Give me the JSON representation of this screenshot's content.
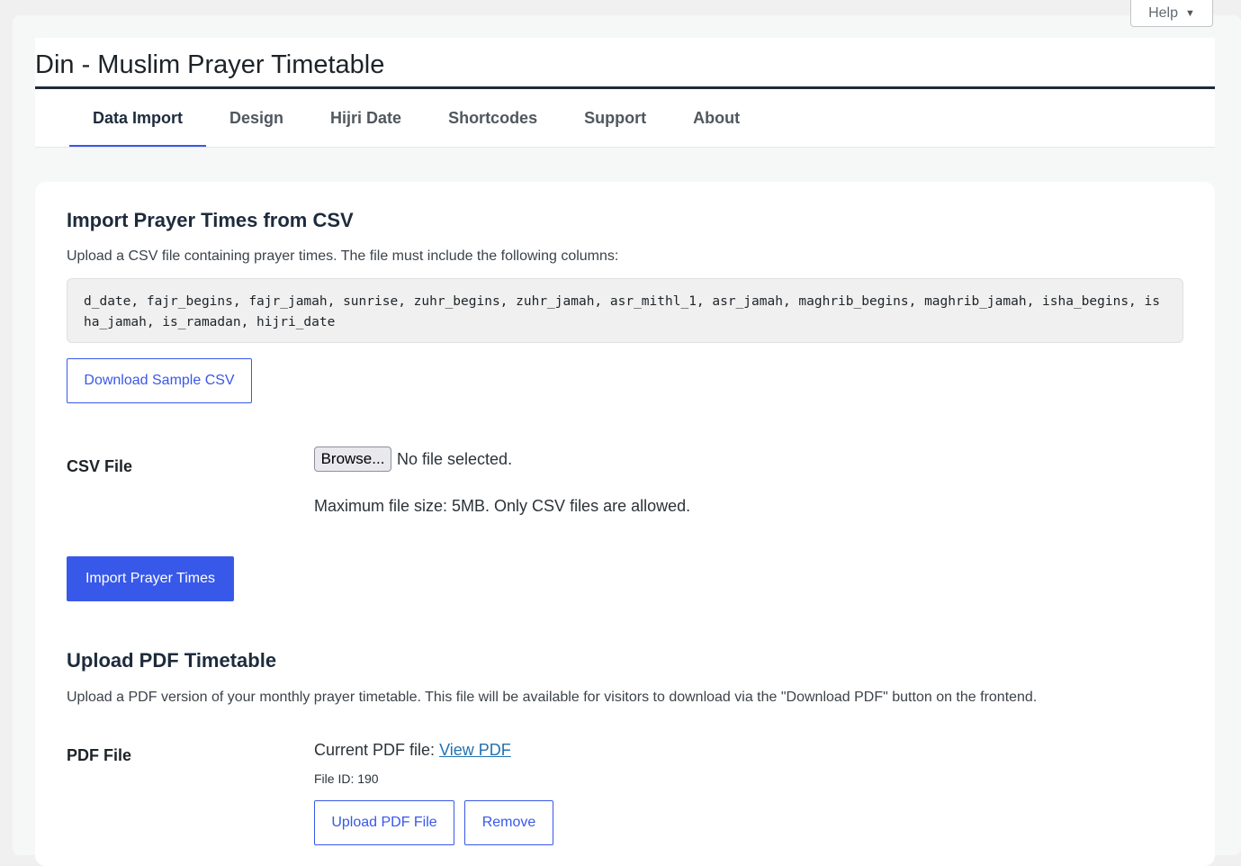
{
  "help": {
    "label": "Help",
    "caret": "▼"
  },
  "header": {
    "title": "Din - Muslim Prayer Timetable"
  },
  "tabs": [
    {
      "label": "Data Import",
      "active": true
    },
    {
      "label": "Design"
    },
    {
      "label": "Hijri Date"
    },
    {
      "label": "Shortcodes"
    },
    {
      "label": "Support"
    },
    {
      "label": "About"
    }
  ],
  "csv_section": {
    "heading": "Import Prayer Times from CSV",
    "description": "Upload a CSV file containing prayer times. The file must include the following columns:",
    "columns_text": "d_date, fajr_begins, fajr_jamah, sunrise, zuhr_begins, zuhr_jamah, asr_mithl_1, asr_jamah, maghrib_begins, maghrib_jamah, isha_begins, isha_jamah, is_ramadan, hijri_date",
    "download_button": "Download Sample CSV",
    "file_label": "CSV File",
    "browse_button": "Browse...",
    "file_status": "No file selected.",
    "hint": "Maximum file size: 5MB. Only CSV files are allowed.",
    "import_button": "Import Prayer Times"
  },
  "pdf_section": {
    "heading": "Upload PDF Timetable",
    "description": "Upload a PDF version of your monthly prayer timetable. This file will be available for visitors to download via the \"Download PDF\" button on the frontend.",
    "file_label": "PDF File",
    "current_label": "Current PDF file:",
    "view_link": "View PDF",
    "file_id": "File ID: 190",
    "upload_button": "Upload PDF File",
    "remove_button": "Remove"
  },
  "colors": {
    "accent": "#3858e9",
    "link": "#2271b1",
    "title_rule": "#1d2b3c"
  }
}
